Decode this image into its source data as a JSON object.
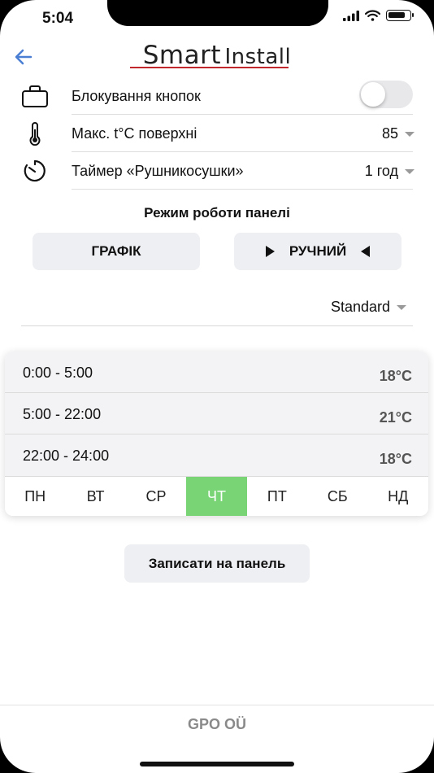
{
  "status_bar": {
    "time": "5:04",
    "battery_level": 0.85
  },
  "header": {
    "logo_smart": "Smart",
    "logo_install": "Install",
    "back_icon": "arrow-left-icon"
  },
  "settings": {
    "button_lock": {
      "label": "Блокування кнопок",
      "enabled": false,
      "icon": "briefcase-icon"
    },
    "max_temp": {
      "label": "Макс. t°C поверхні",
      "value": "85",
      "icon": "thermometer-icon"
    },
    "timer": {
      "label": "Таймер «Рушникосушки»",
      "value": "1 год",
      "icon": "timer-icon"
    }
  },
  "mode": {
    "title": "Режим роботи панелі",
    "schedule_label": "ГРАФІК",
    "manual_label": "РУЧНИЙ"
  },
  "profile": {
    "selected": "Standard"
  },
  "schedule": {
    "slots": [
      {
        "time": "0:00 - 5:00",
        "temp": "18°C"
      },
      {
        "time": "5:00 - 22:00",
        "temp": "21°C"
      },
      {
        "time": "22:00 - 24:00",
        "temp": "18°C"
      }
    ],
    "days": [
      "ПН",
      "ВТ",
      "СР",
      "ЧТ",
      "ПТ",
      "СБ",
      "НД"
    ],
    "active_day": "ЧТ"
  },
  "save_button": "Записати на панель",
  "footer": "GPO OÜ",
  "colors": {
    "accent": "#4a7fd4",
    "active_day": "#79d475",
    "logo_underline": "#c0282e"
  }
}
